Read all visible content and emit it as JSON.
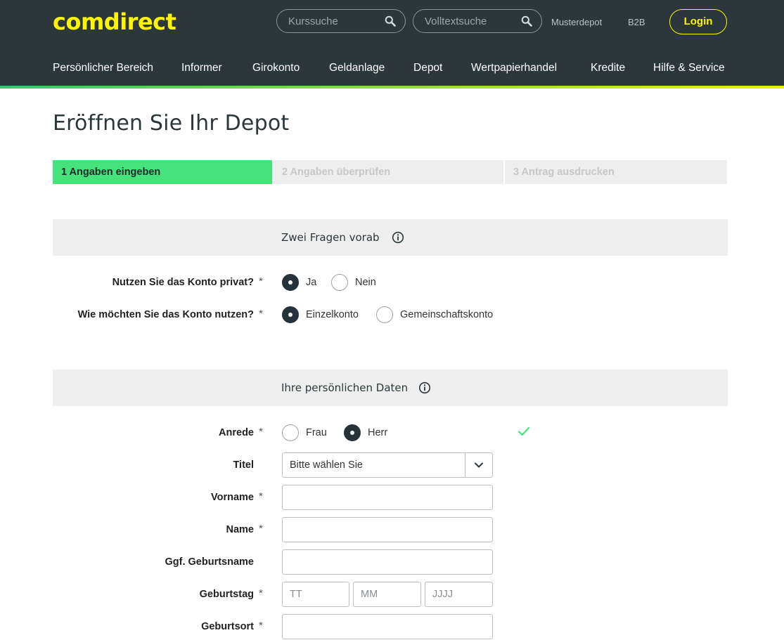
{
  "header": {
    "logo": "comdirect",
    "search_kurs": {
      "placeholder": "Kurssuche"
    },
    "search_volltext": {
      "placeholder": "Volltextsuche"
    },
    "links": {
      "musterdepot": "Musterdepot",
      "b2b": "B2B"
    },
    "login_label": "Login",
    "nav": [
      "Persönlicher Bereich",
      "Informer",
      "Girokonto",
      "Geldanlage",
      "Depot",
      "Wertpapierhandel",
      "Kredite",
      "Hilfe & Service"
    ]
  },
  "page": {
    "title": "Eröffnen Sie Ihr Depot",
    "steps": [
      {
        "label": "1 Angaben eingeben",
        "active": true
      },
      {
        "label": "2 Angaben überprüfen",
        "active": false
      },
      {
        "label": "3 Antrag ausdrucken",
        "active": false
      }
    ]
  },
  "section_questions": {
    "title": "Zwei Fragen vorab",
    "q1": {
      "label": "Nutzen Sie das Konto privat?",
      "required": "*",
      "options": [
        "Ja",
        "Nein"
      ],
      "selected": "Ja"
    },
    "q2": {
      "label": "Wie möchten Sie das Konto nutzen?",
      "required": "*",
      "options": [
        "Einzelkonto",
        "Gemeinschaftskonto"
      ],
      "selected": "Einzelkonto"
    }
  },
  "section_personal": {
    "title": "Ihre persönlichen Daten",
    "anrede": {
      "label": "Anrede",
      "required": "*",
      "options": [
        "Frau",
        "Herr"
      ],
      "selected": "Herr"
    },
    "titel": {
      "label": "Titel",
      "value": "Bitte wählen Sie"
    },
    "vorname": {
      "label": "Vorname",
      "required": "*",
      "value": ""
    },
    "name": {
      "label": "Name",
      "required": "*",
      "value": ""
    },
    "geburtsname": {
      "label": "Ggf. Geburtsname",
      "value": ""
    },
    "geburtstag": {
      "label": "Geburtstag",
      "required": "*",
      "day_placeholder": "TT",
      "month_placeholder": "MM",
      "year_placeholder": "JJJJ"
    },
    "geburtsort": {
      "label": "Geburtsort",
      "required": "*",
      "value": ""
    }
  },
  "colors": {
    "header_bg": "#2b373a",
    "brand_yellow": "#fff500",
    "step_active": "#46e27b",
    "radio_checked": "#26333a",
    "valid_check": "#46e27b"
  },
  "icons": [
    "search-icon",
    "info-icon",
    "chevron-down-icon",
    "checkmark-icon"
  ]
}
